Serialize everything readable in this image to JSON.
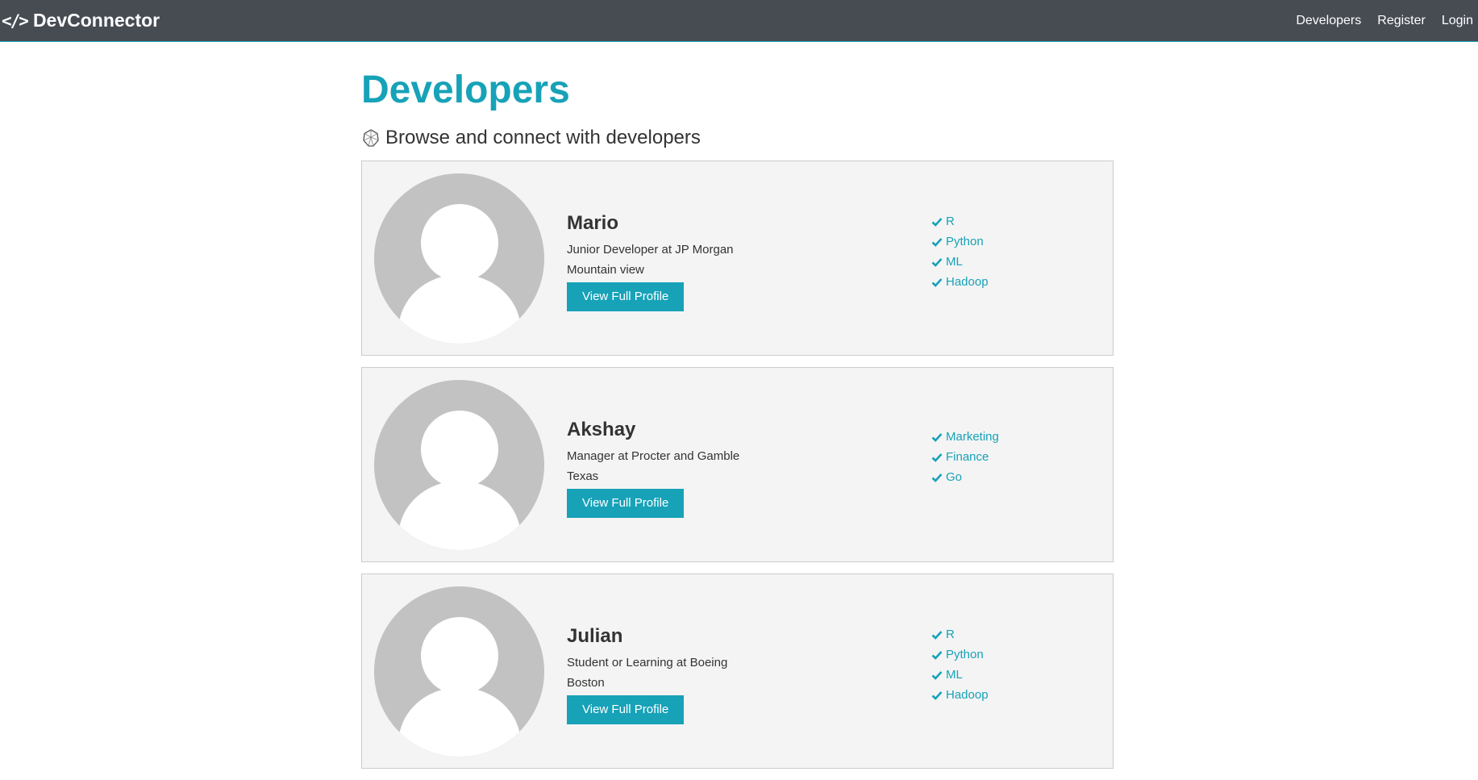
{
  "nav": {
    "brand": "DevConnector",
    "brand_icon": "code-icon",
    "links": [
      "Developers",
      "Register",
      "Login"
    ]
  },
  "page": {
    "title": "Developers",
    "lead": "Browse and connect with developers",
    "lead_icon": "globe-icon"
  },
  "profiles": [
    {
      "name": "Mario",
      "status": "Junior Developer at JP Morgan",
      "location": "Mountain view",
      "button": "View Full Profile",
      "skills": [
        "R",
        "Python",
        "ML",
        "Hadoop"
      ]
    },
    {
      "name": "Akshay",
      "status": "Manager at Procter and Gamble",
      "location": "Texas",
      "button": "View Full Profile",
      "skills": [
        "Marketing",
        "Finance",
        "Go"
      ]
    },
    {
      "name": "Julian",
      "status": "Student or Learning at Boeing",
      "location": "Boston",
      "button": "View Full Profile",
      "skills": [
        "R",
        "Python",
        "ML",
        "Hadoop"
      ]
    }
  ],
  "colors": {
    "primary": "#17a2b8",
    "navbar": "#474c53",
    "card_bg": "#f4f4f4",
    "avatar_bg": "#c2c2c2"
  }
}
